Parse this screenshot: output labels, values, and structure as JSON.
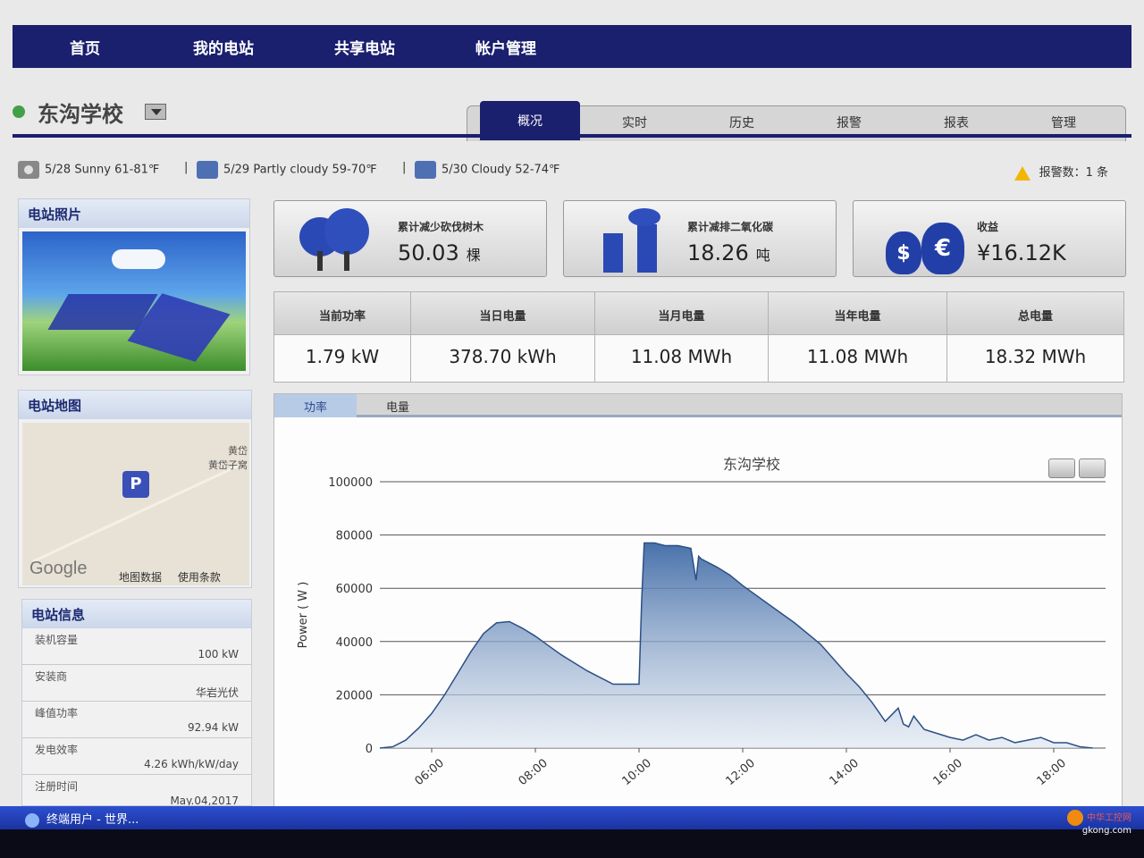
{
  "nav": {
    "items": [
      "首页",
      "我的电站",
      "共享电站",
      "帐户管理"
    ]
  },
  "station": {
    "name": "东沟学校"
  },
  "tabs": [
    "概况",
    "实时",
    "历史",
    "报警",
    "报表",
    "管理"
  ],
  "weather": [
    {
      "icon": "sun-icon",
      "text": "5/28 Sunny 61-81℉"
    },
    {
      "icon": "cloud-icon",
      "text": "5/29 Partly cloudy 59-70℉"
    },
    {
      "icon": "cloud-icon",
      "text": "5/30 Cloudy 52-74℉"
    }
  ],
  "separator": "|",
  "alarm": {
    "text": "报警数：1 条",
    "icon": "warning-icon"
  },
  "panels": {
    "photo_title": "电站照片",
    "map_title": "电站地图",
    "info_title": "电站信息"
  },
  "map": {
    "pin": "P",
    "place_line1": "黄岱",
    "place_line2": "黄岱子窝",
    "logo": "Google",
    "links": [
      "地图数据",
      "使用条款"
    ]
  },
  "info": [
    {
      "label": "装机容量",
      "value": "100 kW"
    },
    {
      "label": "安装商",
      "value": "华岩光伏"
    },
    {
      "label": "峰值功率",
      "value": "92.94 kW"
    },
    {
      "label": "发电效率",
      "value": "4.26 kWh/kW/day"
    },
    {
      "label": "注册时间",
      "value": "May.04,2017"
    }
  ],
  "stats": [
    {
      "icon": "tree-icon",
      "label": "累计减少砍伐树木",
      "value": "50.03",
      "unit": "棵"
    },
    {
      "icon": "factory-icon",
      "label": "累计减排二氧化碳",
      "value": "18.26",
      "unit": "吨"
    },
    {
      "icon": "money-bag-icon",
      "label": "收益",
      "value": "¥16.12K",
      "unit": ""
    }
  ],
  "energy": {
    "headers": [
      "当前功率",
      "当日电量",
      "当月电量",
      "当年电量",
      "总电量"
    ],
    "values": [
      "1.79 kW",
      "378.70 kWh",
      "11.08 MWh",
      "11.08 MWh",
      "18.32 MWh"
    ]
  },
  "chart_tabs": [
    "功率",
    "电量"
  ],
  "chart_buttons": [
    "print-icon",
    "export-icon"
  ],
  "chart_data": {
    "type": "area",
    "title": "东沟学校",
    "xlabel": "",
    "ylabel": "Power ( W )",
    "ylim": [
      0,
      100000
    ],
    "yticks": [
      0,
      20000,
      40000,
      60000,
      80000,
      100000
    ],
    "xticks": [
      "06:00",
      "08:00",
      "10:00",
      "12:00",
      "14:00",
      "16:00",
      "18:00"
    ],
    "grid": true,
    "color": "#3f6aa6",
    "series": [
      {
        "x": [
          5.0,
          5.25,
          5.5,
          5.75,
          6.0,
          6.25,
          6.5,
          6.75,
          7.0,
          7.25,
          7.5,
          7.75,
          8.0,
          8.25,
          8.5,
          9.0,
          9.5,
          10.0,
          10.05,
          10.1,
          10.3,
          10.5,
          10.75,
          11.0,
          11.1,
          11.15,
          11.2,
          11.3,
          11.5,
          11.75,
          12.0,
          12.5,
          13.0,
          13.5,
          14.0,
          14.25,
          14.5,
          14.75,
          15.0,
          15.1,
          15.2,
          15.3,
          15.5,
          15.75,
          16.0,
          16.25,
          16.5,
          16.75,
          17.0,
          17.25,
          17.5,
          17.75,
          18.0,
          18.25,
          18.5,
          18.75
        ],
        "y": [
          0,
          500,
          3000,
          7500,
          13000,
          20000,
          28000,
          36000,
          43000,
          47000,
          47500,
          45000,
          42000,
          38500,
          35000,
          29000,
          24000,
          24000,
          55000,
          77000,
          77000,
          76000,
          76000,
          75000,
          63000,
          72000,
          71000,
          70000,
          68000,
          65000,
          61000,
          54000,
          47000,
          39000,
          28000,
          23000,
          17000,
          10000,
          15000,
          9000,
          8000,
          12000,
          7000,
          5500,
          4000,
          3000,
          5000,
          3000,
          4000,
          2000,
          3000,
          4000,
          2000,
          2000,
          500,
          0
        ]
      }
    ]
  },
  "taskbar": {
    "text": "终端用户 - 世界..."
  },
  "watermark": {
    "line1": "中华工控网",
    "line2": "gkong.com"
  }
}
